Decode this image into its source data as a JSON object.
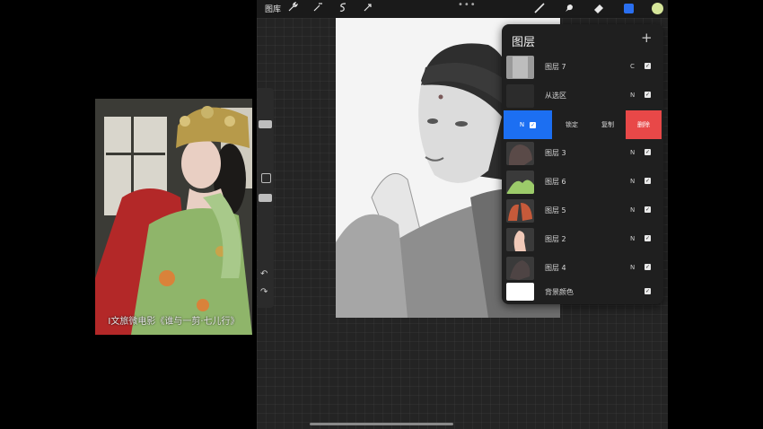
{
  "toolbar": {
    "gallery_label": "图库",
    "more_label": "•••",
    "tools": [
      "wrench-icon",
      "magic-wand-icon",
      "selection-icon",
      "transform-icon"
    ],
    "right_tools": [
      "brush-icon",
      "smudge-icon",
      "eraser-icon",
      "layers-icon"
    ],
    "current_color": "#d6e69a"
  },
  "layers_panel": {
    "title": "图层",
    "add_label": "+",
    "layers": [
      {
        "name": "图层 7",
        "blend": "C",
        "visible": true
      },
      {
        "name": "从选区",
        "blend": "N",
        "visible": true
      },
      {
        "name": "图层 3",
        "blend": "N",
        "visible": true
      },
      {
        "name": "图层 6",
        "blend": "N",
        "visible": true
      },
      {
        "name": "图层 5",
        "blend": "N",
        "visible": true
      },
      {
        "name": "图层 2",
        "blend": "N",
        "visible": true
      },
      {
        "name": "图层 4",
        "blend": "N",
        "visible": true
      },
      {
        "name": "背景颜色",
        "blend": "",
        "visible": true
      }
    ],
    "actions": {
      "blend": "N",
      "lock": "锁定",
      "duplicate": "复制",
      "delete": "删除"
    }
  },
  "photo": {
    "caption": "I文旅微电影《谁与一剪·七儿行》"
  },
  "colors": {
    "accent": "#1c6ff2",
    "delete": "#e84848",
    "panel": "#1f1f1f"
  }
}
